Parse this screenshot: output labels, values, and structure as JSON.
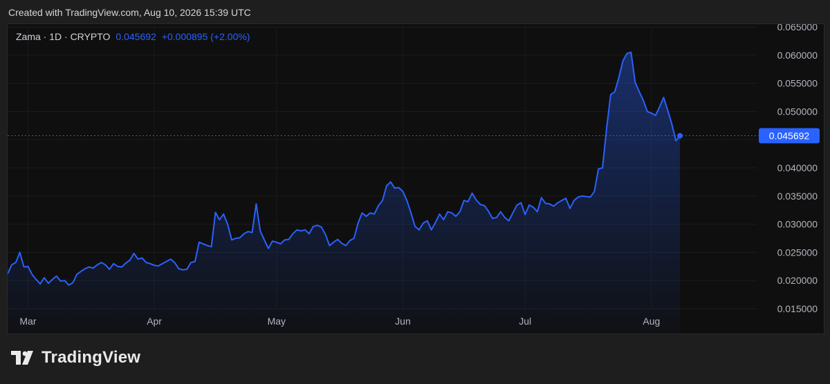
{
  "caption": "Created with TradingView.com, Aug 10, 2026 15:39 UTC",
  "legend": {
    "symbol": "Zama · 1D · CRYPTO",
    "value": "0.045692",
    "change": "+0.000895 (+2.00%)"
  },
  "last_price_label": "0.045692",
  "brand": "TradingView",
  "colors": {
    "line": "#2962ff",
    "background": "#0f0f0f",
    "axis_text": "#b2b5be"
  },
  "chart_data": {
    "type": "area",
    "ylim": [
      0.015,
      0.065
    ],
    "y_ticks": [
      "0.065000",
      "0.060000",
      "0.055000",
      "0.050000",
      "0.045000",
      "0.040000",
      "0.035000",
      "0.030000",
      "0.025000",
      "0.020000",
      "0.015000"
    ],
    "x_ticks": [
      {
        "label": "Mar",
        "date": "2026-03-01"
      },
      {
        "label": "Apr",
        "date": "2026-04-01"
      },
      {
        "label": "May",
        "date": "2026-05-01"
      },
      {
        "label": "Jun",
        "date": "2026-06-01"
      },
      {
        "label": "Jul",
        "date": "2026-07-01"
      },
      {
        "label": "Aug",
        "date": "2026-08-01"
      }
    ],
    "x_start": "2026-02-24",
    "x_end": "2026-08-27",
    "last_value": 0.045692,
    "series": [
      {
        "values": [
          [
            "2026-02-24",
            0.0212
          ],
          [
            "2026-02-25",
            0.0228
          ],
          [
            "2026-02-26",
            0.0232
          ],
          [
            "2026-02-27",
            0.025
          ],
          [
            "2026-02-28",
            0.0224
          ],
          [
            "2026-03-01",
            0.0225
          ],
          [
            "2026-03-02",
            0.0211
          ],
          [
            "2026-03-03",
            0.0202
          ],
          [
            "2026-03-04",
            0.0194
          ],
          [
            "2026-03-05",
            0.0205
          ],
          [
            "2026-03-06",
            0.0195
          ],
          [
            "2026-03-07",
            0.0202
          ],
          [
            "2026-03-08",
            0.0208
          ],
          [
            "2026-03-09",
            0.0199
          ],
          [
            "2026-03-10",
            0.02
          ],
          [
            "2026-03-11",
            0.0192
          ],
          [
            "2026-03-12",
            0.0196
          ],
          [
            "2026-03-13",
            0.0211
          ],
          [
            "2026-03-14",
            0.0216
          ],
          [
            "2026-03-15",
            0.0221
          ],
          [
            "2026-03-16",
            0.0224
          ],
          [
            "2026-03-17",
            0.0222
          ],
          [
            "2026-03-18",
            0.0228
          ],
          [
            "2026-03-19",
            0.0232
          ],
          [
            "2026-03-20",
            0.0228
          ],
          [
            "2026-03-21",
            0.022
          ],
          [
            "2026-03-22",
            0.023
          ],
          [
            "2026-03-23",
            0.0225
          ],
          [
            "2026-03-24",
            0.0224
          ],
          [
            "2026-03-25",
            0.0231
          ],
          [
            "2026-03-26",
            0.0236
          ],
          [
            "2026-03-27",
            0.0248
          ],
          [
            "2026-03-28",
            0.0238
          ],
          [
            "2026-03-29",
            0.024
          ],
          [
            "2026-03-30",
            0.0232
          ],
          [
            "2026-03-31",
            0.023
          ],
          [
            "2026-04-01",
            0.0227
          ],
          [
            "2026-04-02",
            0.0226
          ],
          [
            "2026-04-03",
            0.023
          ],
          [
            "2026-04-04",
            0.0234
          ],
          [
            "2026-04-05",
            0.0238
          ],
          [
            "2026-04-06",
            0.0232
          ],
          [
            "2026-04-07",
            0.0221
          ],
          [
            "2026-04-08",
            0.0219
          ],
          [
            "2026-04-09",
            0.022
          ],
          [
            "2026-04-10",
            0.0232
          ],
          [
            "2026-04-11",
            0.0234
          ],
          [
            "2026-04-12",
            0.0268
          ],
          [
            "2026-04-13",
            0.0265
          ],
          [
            "2026-04-14",
            0.0262
          ],
          [
            "2026-04-15",
            0.026
          ],
          [
            "2026-04-16",
            0.0321
          ],
          [
            "2026-04-17",
            0.0308
          ],
          [
            "2026-04-18",
            0.0318
          ],
          [
            "2026-04-19",
            0.03
          ],
          [
            "2026-04-20",
            0.0272
          ],
          [
            "2026-04-21",
            0.0275
          ],
          [
            "2026-04-22",
            0.0276
          ],
          [
            "2026-04-23",
            0.0283
          ],
          [
            "2026-04-24",
            0.0287
          ],
          [
            "2026-04-25",
            0.0285
          ],
          [
            "2026-04-26",
            0.0336
          ],
          [
            "2026-04-27",
            0.0288
          ],
          [
            "2026-04-28",
            0.0272
          ],
          [
            "2026-04-29",
            0.0257
          ],
          [
            "2026-04-30",
            0.027
          ],
          [
            "2026-05-01",
            0.0268
          ],
          [
            "2026-05-02",
            0.0265
          ],
          [
            "2026-05-03",
            0.0272
          ],
          [
            "2026-05-04",
            0.0273
          ],
          [
            "2026-05-05",
            0.0283
          ],
          [
            "2026-05-06",
            0.029
          ],
          [
            "2026-05-07",
            0.0288
          ],
          [
            "2026-05-08",
            0.029
          ],
          [
            "2026-05-09",
            0.0283
          ],
          [
            "2026-05-10",
            0.0296
          ],
          [
            "2026-05-11",
            0.0298
          ],
          [
            "2026-05-12",
            0.0295
          ],
          [
            "2026-05-13",
            0.0282
          ],
          [
            "2026-05-14",
            0.0262
          ],
          [
            "2026-05-15",
            0.0268
          ],
          [
            "2026-05-16",
            0.0273
          ],
          [
            "2026-05-17",
            0.0266
          ],
          [
            "2026-05-18",
            0.0262
          ],
          [
            "2026-05-19",
            0.0271
          ],
          [
            "2026-05-20",
            0.0275
          ],
          [
            "2026-05-21",
            0.0302
          ],
          [
            "2026-05-22",
            0.032
          ],
          [
            "2026-05-23",
            0.0314
          ],
          [
            "2026-05-24",
            0.032
          ],
          [
            "2026-05-25",
            0.0318
          ],
          [
            "2026-05-26",
            0.0333
          ],
          [
            "2026-05-27",
            0.0342
          ],
          [
            "2026-05-28",
            0.0368
          ],
          [
            "2026-05-29",
            0.0375
          ],
          [
            "2026-05-30",
            0.0364
          ],
          [
            "2026-05-31",
            0.0365
          ],
          [
            "2026-06-01",
            0.0358
          ],
          [
            "2026-06-02",
            0.0342
          ],
          [
            "2026-06-03",
            0.032
          ],
          [
            "2026-06-04",
            0.0296
          ],
          [
            "2026-06-05",
            0.029
          ],
          [
            "2026-06-06",
            0.0302
          ],
          [
            "2026-06-07",
            0.0306
          ],
          [
            "2026-06-08",
            0.029
          ],
          [
            "2026-06-09",
            0.0303
          ],
          [
            "2026-06-10",
            0.0318
          ],
          [
            "2026-06-11",
            0.0308
          ],
          [
            "2026-06-12",
            0.0322
          ],
          [
            "2026-06-13",
            0.032
          ],
          [
            "2026-06-14",
            0.0314
          ],
          [
            "2026-06-15",
            0.0322
          ],
          [
            "2026-06-16",
            0.0342
          ],
          [
            "2026-06-17",
            0.034
          ],
          [
            "2026-06-18",
            0.0355
          ],
          [
            "2026-06-19",
            0.0343
          ],
          [
            "2026-06-20",
            0.0335
          ],
          [
            "2026-06-21",
            0.0333
          ],
          [
            "2026-06-22",
            0.0323
          ],
          [
            "2026-06-23",
            0.031
          ],
          [
            "2026-06-24",
            0.0312
          ],
          [
            "2026-06-25",
            0.0322
          ],
          [
            "2026-06-26",
            0.0312
          ],
          [
            "2026-06-27",
            0.0306
          ],
          [
            "2026-06-28",
            0.032
          ],
          [
            "2026-06-29",
            0.0334
          ],
          [
            "2026-06-30",
            0.0338
          ],
          [
            "2026-07-01",
            0.0317
          ],
          [
            "2026-07-02",
            0.0334
          ],
          [
            "2026-07-03",
            0.033
          ],
          [
            "2026-07-04",
            0.0322
          ],
          [
            "2026-07-05",
            0.0347
          ],
          [
            "2026-07-06",
            0.0337
          ],
          [
            "2026-07-07",
            0.0336
          ],
          [
            "2026-07-08",
            0.0332
          ],
          [
            "2026-07-09",
            0.0338
          ],
          [
            "2026-07-10",
            0.0342
          ],
          [
            "2026-07-11",
            0.0346
          ],
          [
            "2026-07-12",
            0.0328
          ],
          [
            "2026-07-13",
            0.0342
          ],
          [
            "2026-07-14",
            0.0348
          ],
          [
            "2026-07-15",
            0.035
          ],
          [
            "2026-07-16",
            0.0349
          ],
          [
            "2026-07-17",
            0.0348
          ],
          [
            "2026-07-18",
            0.0358
          ],
          [
            "2026-07-19",
            0.0398
          ],
          [
            "2026-07-20",
            0.04
          ],
          [
            "2026-07-21",
            0.047
          ],
          [
            "2026-07-22",
            0.053
          ],
          [
            "2026-07-23",
            0.0535
          ],
          [
            "2026-07-24",
            0.056
          ],
          [
            "2026-07-25",
            0.059
          ],
          [
            "2026-07-26",
            0.0603
          ],
          [
            "2026-07-27",
            0.0605
          ],
          [
            "2026-07-28",
            0.0552
          ],
          [
            "2026-07-29",
            0.0535
          ],
          [
            "2026-07-30",
            0.052
          ],
          [
            "2026-07-31",
            0.05
          ],
          [
            "2026-08-01",
            0.0497
          ],
          [
            "2026-08-02",
            0.0493
          ],
          [
            "2026-08-03",
            0.0508
          ],
          [
            "2026-08-04",
            0.0525
          ],
          [
            "2026-08-05",
            0.0502
          ],
          [
            "2026-08-06",
            0.0478
          ],
          [
            "2026-08-07",
            0.0448
          ],
          [
            "2026-08-08",
            0.04569
          ]
        ]
      }
    ]
  }
}
